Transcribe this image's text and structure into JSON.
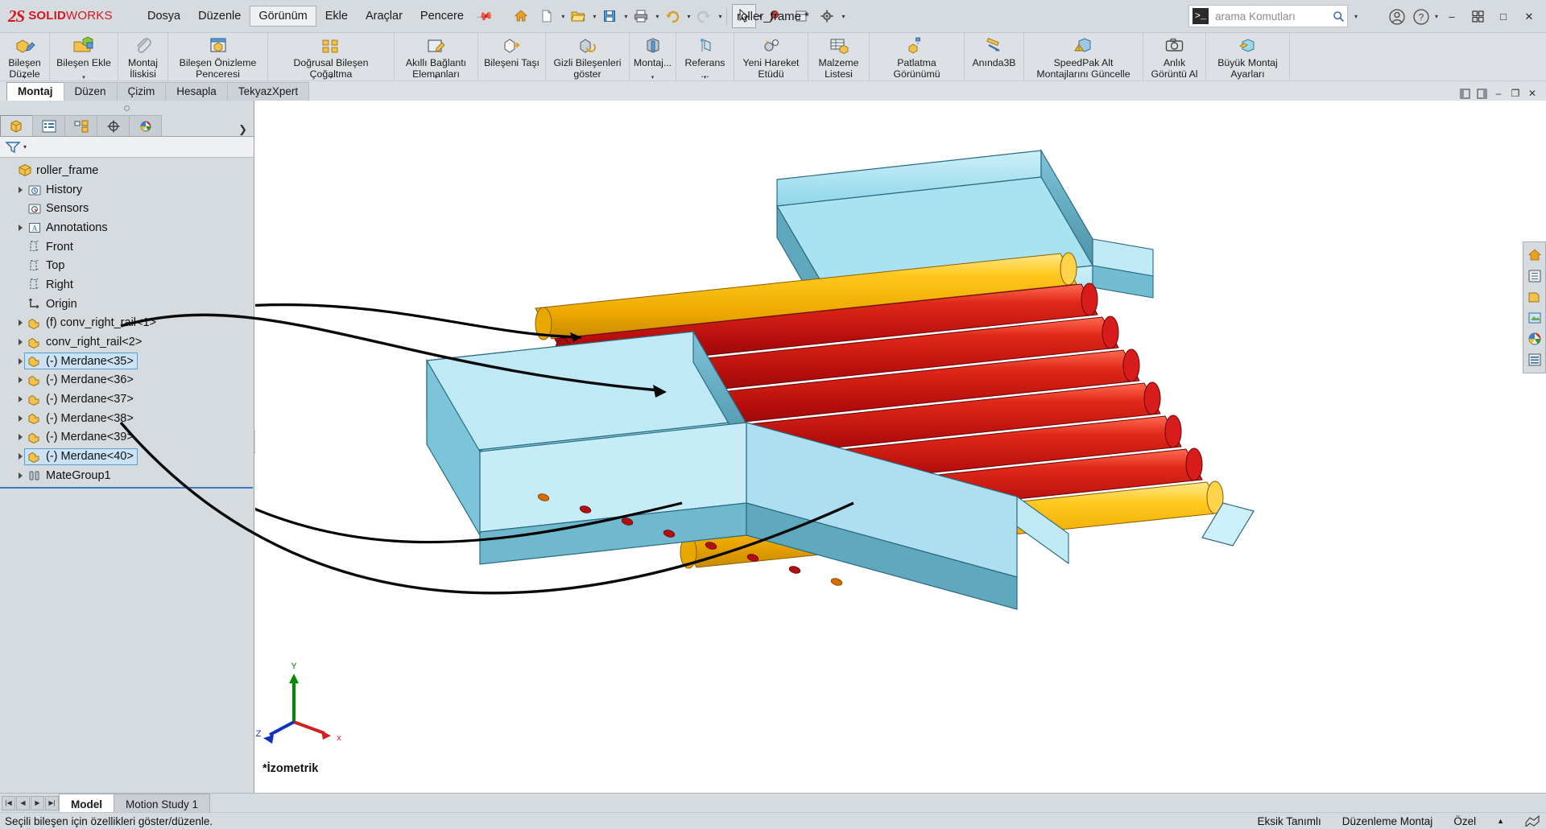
{
  "app": {
    "brand_ds": "2S",
    "brand_solid": "SOLID",
    "brand_works": "WORKS",
    "document_title": "roller_frame *",
    "accent_red": "#d4171f",
    "chrome_bg": "#d6dbe0"
  },
  "menu": {
    "items": [
      {
        "label": "Dosya",
        "active": false
      },
      {
        "label": "Düzenle",
        "active": false
      },
      {
        "label": "Görünüm",
        "active": true
      },
      {
        "label": "Ekle",
        "active": false
      },
      {
        "label": "Araçlar",
        "active": false
      },
      {
        "label": "Pencere",
        "active": false
      }
    ],
    "pin_icon": "pushpin-icon"
  },
  "quick_access": {
    "buttons": [
      {
        "name": "home-icon",
        "label": "Home"
      },
      {
        "name": "new-document-icon",
        "label": "Yeni"
      },
      {
        "name": "open-document-icon",
        "label": "Aç"
      },
      {
        "name": "save-icon",
        "label": "Kaydet"
      },
      {
        "name": "print-icon",
        "label": "Yazdır"
      },
      {
        "name": "undo-icon",
        "label": "Geri Al"
      },
      {
        "name": "redo-icon",
        "label": "Yinele"
      },
      {
        "name": "select-cursor-icon",
        "label": "Seç"
      },
      {
        "name": "magnify-glass-icon",
        "label": "Büyüteç"
      },
      {
        "name": "rebuild-icon",
        "label": "Yeniden Oluştur"
      },
      {
        "name": "display-style-icon",
        "label": "Görüntüleme"
      },
      {
        "name": "options-gear-icon",
        "label": "Seçenekler"
      }
    ]
  },
  "search": {
    "placeholder": "arama Komutları",
    "prompt_glyph": ">_",
    "magnifier": "search-icon",
    "dropdown": "chevron-down-icon"
  },
  "titlebar_right": {
    "account_icon": "user-account-icon",
    "help_icon": "help-question-icon",
    "minimize": "–",
    "restore_grid": "grid-windows-icon",
    "maximize": "□",
    "close": "✕"
  },
  "ribbon": {
    "items": [
      {
        "label": "Bileşen\nDüzele",
        "icon": "edit-component-icon",
        "caret": true
      },
      {
        "label": "Bileşen Ekle",
        "icon": "insert-component-icon",
        "caret": true
      },
      {
        "label": "Montaj\nİliskisi",
        "icon": "mate-paperclip-icon",
        "caret": false
      },
      {
        "label": "Bileşen Önizleme\nPenceresi",
        "icon": "component-preview-icon",
        "caret": false
      },
      {
        "label": "Doğrusal Bileşen Çoğaltma",
        "icon": "linear-pattern-icon",
        "caret": true
      },
      {
        "label": "Akıllı Bağlantı\nElemanları",
        "icon": "smart-fasteners-icon",
        "caret": true
      },
      {
        "label": "Bileşeni Taşı",
        "icon": "move-component-icon",
        "caret": false
      },
      {
        "label": "Gizli Bileşenleri\ngöster",
        "icon": "show-hidden-components-icon",
        "caret": false
      },
      {
        "label": "Montaj...",
        "icon": "assembly-features-icon",
        "caret": true
      },
      {
        "label": "Referans ...",
        "icon": "reference-geometry-icon",
        "caret": true
      },
      {
        "label": "Yeni Hareket\nEtüdü",
        "icon": "new-motion-study-icon",
        "caret": false
      },
      {
        "label": "Malzeme\nListesi",
        "icon": "bill-of-materials-icon",
        "caret": false
      },
      {
        "label": "Patlatma Görünümü",
        "icon": "exploded-view-icon",
        "caret": false
      },
      {
        "label": "Anında3B",
        "icon": "instant3d-icon",
        "caret": false
      },
      {
        "label": "SpeedPak Alt\nMontajlarını Güncelle",
        "icon": "speedpak-update-icon",
        "caret": false
      },
      {
        "label": "Anlık\nGörüntü Al",
        "icon": "camera-snapshot-icon",
        "caret": false
      },
      {
        "label": "Büyük Montaj\nAyarları",
        "icon": "large-assembly-settings-icon",
        "caret": false
      }
    ]
  },
  "command_tabs": [
    {
      "label": "Montaj",
      "active": true
    },
    {
      "label": "Düzen",
      "active": false
    },
    {
      "label": "Çizim",
      "active": false
    },
    {
      "label": "Hesapla",
      "active": false
    },
    {
      "label": "TekyazXpert",
      "active": false
    }
  ],
  "heads_up_toolbar": {
    "buttons": [
      {
        "name": "zoom-to-fit-icon",
        "caret": false
      },
      {
        "name": "zoom-to-area-icon",
        "caret": false
      },
      {
        "name": "previous-view-icon",
        "caret": false
      },
      {
        "name": "section-view-icon",
        "caret": false
      },
      {
        "name": "view-orientation-icon",
        "caret": true
      },
      {
        "name": "display-style-icon",
        "caret": true
      },
      {
        "name": "hide-show-items-icon",
        "caret": true
      },
      {
        "name": "edit-appearance-icon",
        "caret": false
      },
      {
        "name": "apply-scene-icon",
        "caret": true
      },
      {
        "name": "view-settings-icon",
        "caret": true
      }
    ]
  },
  "window_ctrls_viewport": {
    "buttons": [
      "restore-panel-icon",
      "split-panel-icon",
      "minimize-doc-icon",
      "restore-doc-icon",
      "close-doc-icon"
    ]
  },
  "feature_tree": {
    "tabs": [
      {
        "name": "feature-manager-tab",
        "active": true
      },
      {
        "name": "property-manager-tab",
        "active": false
      },
      {
        "name": "configuration-manager-tab",
        "active": false
      },
      {
        "name": "dimxpert-manager-tab",
        "active": false
      },
      {
        "name": "display-manager-tab",
        "active": false
      }
    ],
    "more_chevron": "chevron-right-icon",
    "filter_icon": "filter-funnel-icon",
    "nodes": [
      {
        "label": "roller_frame",
        "icon": "assembly-icon",
        "indent": 0,
        "twisty": false,
        "selected": false
      },
      {
        "label": "History",
        "icon": "history-folder-icon",
        "indent": 1,
        "twisty": true,
        "selected": false
      },
      {
        "label": "Sensors",
        "icon": "sensors-folder-icon",
        "indent": 1,
        "twisty": false,
        "selected": false
      },
      {
        "label": "Annotations",
        "icon": "annotations-icon",
        "indent": 1,
        "twisty": true,
        "selected": false
      },
      {
        "label": "Front",
        "icon": "plane-icon",
        "indent": 1,
        "twisty": false,
        "selected": false
      },
      {
        "label": "Top",
        "icon": "plane-icon",
        "indent": 1,
        "twisty": false,
        "selected": false
      },
      {
        "label": "Right",
        "icon": "plane-icon",
        "indent": 1,
        "twisty": false,
        "selected": false
      },
      {
        "label": "Origin",
        "icon": "origin-icon",
        "indent": 1,
        "twisty": false,
        "selected": false
      },
      {
        "label": "(f) conv_right_rail<1>",
        "icon": "part-icon",
        "indent": 1,
        "twisty": true,
        "selected": false
      },
      {
        "label": "conv_right_rail<2>",
        "icon": "part-icon",
        "indent": 1,
        "twisty": true,
        "selected": false
      },
      {
        "label": "(-) Merdane<35>",
        "icon": "part-icon",
        "indent": 1,
        "twisty": true,
        "selected": true
      },
      {
        "label": "(-) Merdane<36>",
        "icon": "part-icon",
        "indent": 1,
        "twisty": true,
        "selected": false
      },
      {
        "label": "(-) Merdane<37>",
        "icon": "part-icon",
        "indent": 1,
        "twisty": true,
        "selected": false
      },
      {
        "label": "(-) Merdane<38>",
        "icon": "part-icon",
        "indent": 1,
        "twisty": true,
        "selected": false
      },
      {
        "label": "(-) Merdane<39>",
        "icon": "part-icon",
        "indent": 1,
        "twisty": true,
        "selected": false
      },
      {
        "label": "(-) Merdane<40>",
        "icon": "part-icon",
        "indent": 1,
        "twisty": true,
        "selected": true
      },
      {
        "label": "MateGroup1",
        "icon": "mategroup-icon",
        "indent": 1,
        "twisty": true,
        "selected": false
      }
    ]
  },
  "viewport": {
    "view_label": "*İzometrik",
    "triad": {
      "x": "x",
      "y": "Y",
      "z": "Z",
      "x_color": "#d02020",
      "y_color": "#008a00",
      "z_color": "#1030c0"
    },
    "model": {
      "name": "roller conveyor frame assembly",
      "rail_color": "#8fd6e8",
      "rail_shade": "#4c94a8",
      "roller_red": "#cc1111",
      "roller_yellow": "#ffc000",
      "roller_count": 8
    },
    "callouts": 2
  },
  "right_dock": {
    "buttons": [
      {
        "name": "home-design-library-icon"
      },
      {
        "name": "file-explorer-icon"
      },
      {
        "name": "view-palette-icon"
      },
      {
        "name": "appearances-icon"
      },
      {
        "name": "custom-properties-icon"
      },
      {
        "name": "search-library-icon"
      }
    ]
  },
  "bottom": {
    "nav_buttons": [
      "first-tab-icon",
      "previous-tab-icon",
      "next-tab-icon",
      "last-tab-icon"
    ],
    "tabs": [
      {
        "label": "Model",
        "active": true
      },
      {
        "label": "Motion Study 1",
        "active": false
      }
    ]
  },
  "status_bar": {
    "message": "Seçili bileşen için özellikleri göster/düzenle.",
    "under_defined": "Eksik Tanımlı",
    "edit_mode": "Düzenleme Montaj",
    "units": "Özel",
    "units_caret": "▲",
    "overlay_icon": "display-overlay-icon"
  }
}
